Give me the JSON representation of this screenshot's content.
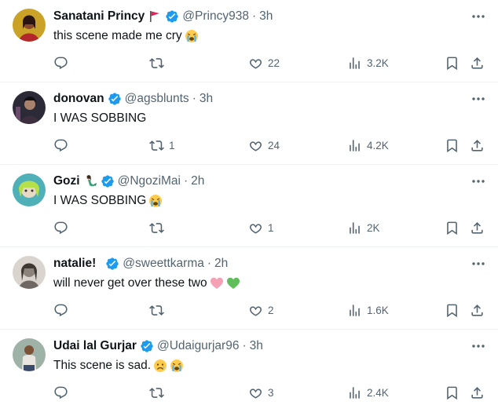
{
  "replies": [
    {
      "name": "Sanatani Princy",
      "extra_icon": "red-flag-icon",
      "handle": "@Princy938",
      "time": "3h",
      "text": "this scene made me cry",
      "emojis": [
        "crying-face-icon"
      ],
      "reply_count": "",
      "retweet_count": "",
      "like_count": "22",
      "view_count": "3.2K"
    },
    {
      "name": "donovan",
      "extra_icon": "",
      "handle": "@agsblunts",
      "time": "3h",
      "text": "I WAS SOBBING",
      "emojis": [],
      "reply_count": "",
      "retweet_count": "1",
      "like_count": "24",
      "view_count": "4.2K"
    },
    {
      "name": "Gozi",
      "extra_icon": "mermaid-icon",
      "handle": "@NgoziMai",
      "time": "2h",
      "text": "I WAS SOBBING",
      "emojis": [
        "crying-face-icon"
      ],
      "reply_count": "",
      "retweet_count": "",
      "like_count": "1",
      "view_count": "2K"
    },
    {
      "name": "natalie!",
      "extra_icon": "",
      "handle": "@sweettkarma",
      "time": "2h",
      "text": "will never get over these two",
      "emojis": [
        "pink-heart-icon",
        "green-heart-icon"
      ],
      "reply_count": "",
      "retweet_count": "",
      "like_count": "2",
      "view_count": "1.6K"
    },
    {
      "name": "Udai lal Gurjar",
      "extra_icon": "",
      "handle": "@Udaigurjar96",
      "time": "3h",
      "text": "This scene is sad.",
      "emojis": [
        "sad-face-icon",
        "crying-face-icon"
      ],
      "reply_count": "",
      "retweet_count": "",
      "like_count": "3",
      "view_count": "2.4K"
    }
  ],
  "separator": "·",
  "colors": {
    "verified": "#1d9bf0",
    "muted": "#536471",
    "text": "#0f1419",
    "divider": "#eff3f4"
  }
}
